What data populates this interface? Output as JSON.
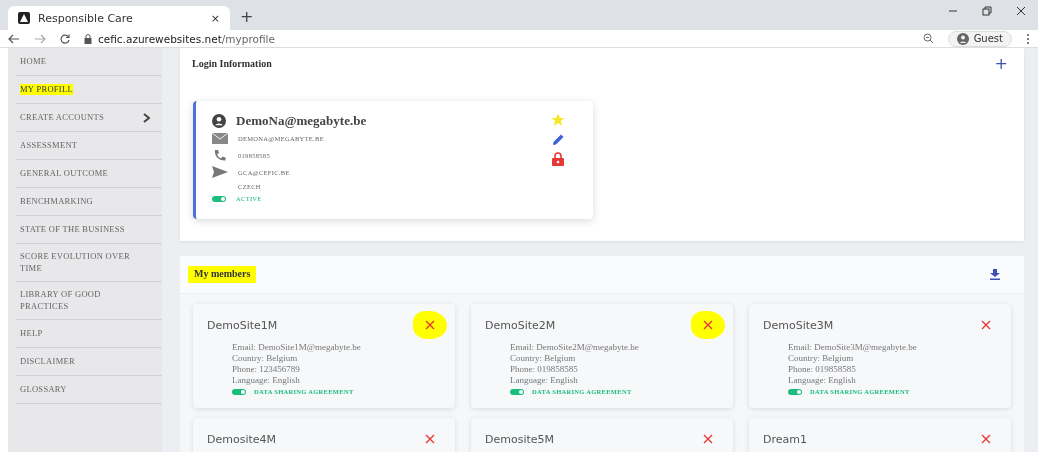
{
  "browser": {
    "tab": {
      "title": "Responsible Care",
      "close": "×"
    },
    "new_tab": "+",
    "url_host": "cefic.azurewebsites.net",
    "url_path": "/myprofile",
    "profile": "Guest"
  },
  "sidebar": {
    "items": [
      {
        "label": "HOME",
        "selected": false,
        "highlighted": false,
        "has_arrow": false
      },
      {
        "label": "MY PROFILL",
        "selected": true,
        "highlighted": true,
        "has_arrow": false
      },
      {
        "label": "CREATE ACCOUNTS",
        "selected": false,
        "highlighted": false,
        "has_arrow": true
      },
      {
        "label": "ASSESSMENT",
        "selected": false,
        "highlighted": false,
        "has_arrow": false
      },
      {
        "label": "GENERAL OUTCOME",
        "selected": false,
        "highlighted": false,
        "has_arrow": false
      },
      {
        "label": "BENCHMARKING",
        "selected": false,
        "highlighted": false,
        "has_arrow": false
      },
      {
        "label": "STATE OF THE BUSINESS",
        "selected": false,
        "highlighted": false,
        "has_arrow": false
      },
      {
        "label": "SCORE EVOLUTION OVER TIME",
        "selected": false,
        "highlighted": false,
        "has_arrow": false
      },
      {
        "label": "LIBRARY OF GOOD PRACTICES",
        "selected": false,
        "highlighted": false,
        "has_arrow": false
      },
      {
        "label": "HELP",
        "selected": false,
        "highlighted": false,
        "has_arrow": false
      },
      {
        "label": "DISCLAIMER",
        "selected": false,
        "highlighted": false,
        "has_arrow": false
      },
      {
        "label": "GLOSSARY",
        "selected": false,
        "highlighted": false,
        "has_arrow": false
      }
    ]
  },
  "login": {
    "title": "Login Information",
    "add": "+",
    "profile": {
      "name": "DemoNa@megabyte.be",
      "email": "DEMONA@MEGABYTE.BE",
      "phone": "019858585",
      "contact": "GCA@CEFIC.BE",
      "country": "CZECH",
      "status": "ACTIVE",
      "active": true
    }
  },
  "members": {
    "title": "My members",
    "title_highlighted": true,
    "items": [
      {
        "name": "DemoSite1M",
        "highlighted": true,
        "fields": [
          {
            "label": "Email:",
            "value": "DemoSite1M@megabyte.be"
          },
          {
            "label": "Country:",
            "value": "Belgium"
          },
          {
            "label": "Phone:",
            "value": "123456789"
          },
          {
            "label": "Language:",
            "value": "English"
          }
        ],
        "agreement": "DATA SHARING AGREEMENT",
        "agreement_on": true
      },
      {
        "name": "DemoSite2M",
        "highlighted": true,
        "fields": [
          {
            "label": "Email:",
            "value": "DemoSite2M@megabyte.be"
          },
          {
            "label": "Country:",
            "value": "Belgium"
          },
          {
            "label": "Phone:",
            "value": "019858585"
          },
          {
            "label": "Language:",
            "value": "English"
          }
        ],
        "agreement": "DATA SHARING AGREEMENT",
        "agreement_on": true
      },
      {
        "name": "DemoSite3M",
        "highlighted": false,
        "fields": [
          {
            "label": "Email:",
            "value": "DemoSite3M@megabyte.be"
          },
          {
            "label": "Country:",
            "value": "Belgium"
          },
          {
            "label": "Phone:",
            "value": "019858585"
          },
          {
            "label": "Language:",
            "value": "English"
          }
        ],
        "agreement": "DATA SHARING AGREEMENT",
        "agreement_on": true
      },
      {
        "name": "Demosite4M",
        "highlighted": false
      },
      {
        "name": "Demosite5M",
        "highlighted": false
      },
      {
        "name": "Dream1",
        "highlighted": false
      }
    ]
  }
}
